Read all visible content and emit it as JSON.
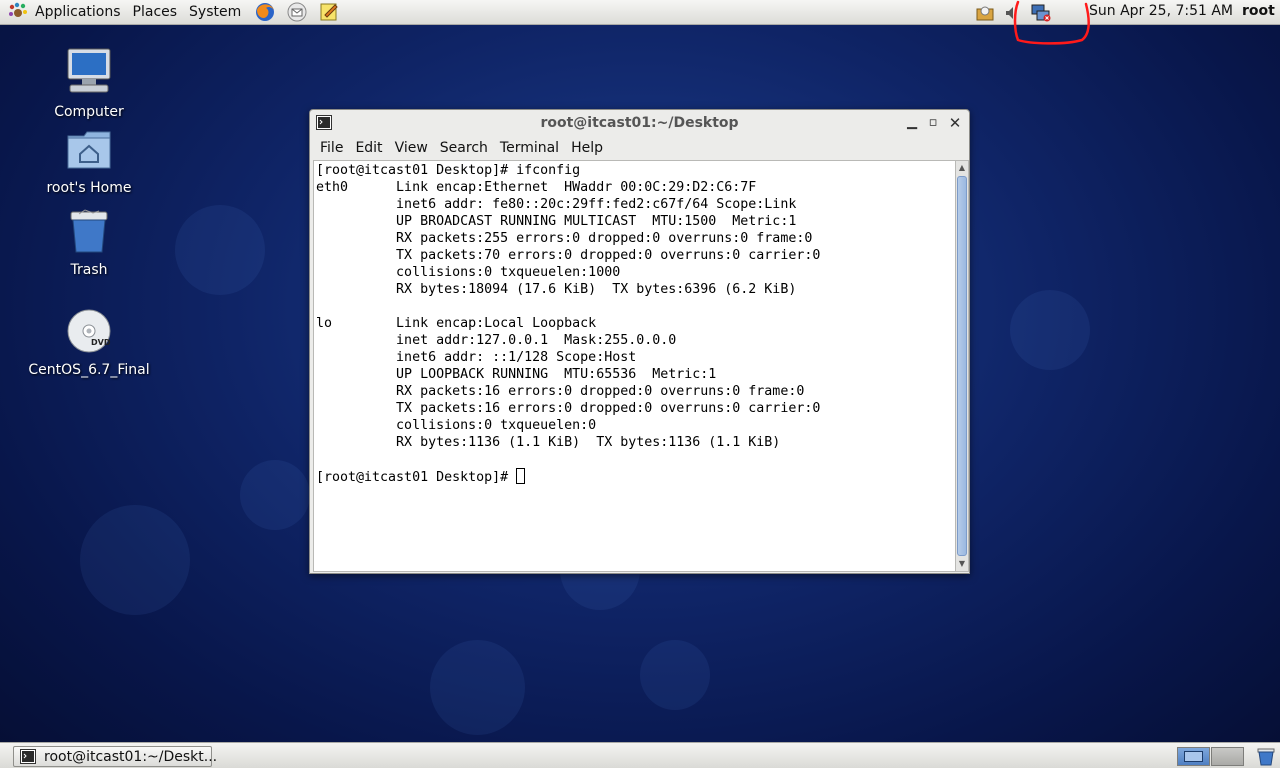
{
  "top_panel": {
    "menus": [
      "Applications",
      "Places",
      "System"
    ],
    "launchers": [
      "firefox-icon",
      "mail-client-icon",
      "notes-editor-icon"
    ],
    "clock": "Sun Apr 25,  7:51 AM",
    "user": "root",
    "tray_icons": [
      "updates-icon",
      "volume-icon",
      "network-disconnected-icon"
    ]
  },
  "desktop": {
    "icons": [
      {
        "label": "Computer",
        "icon": "computer-icon"
      },
      {
        "label": "root's Home",
        "icon": "home-folder-icon"
      },
      {
        "label": "Trash",
        "icon": "trash-icon"
      },
      {
        "label": "CentOS_6.7_Final",
        "icon": "dvd-icon"
      }
    ]
  },
  "terminal": {
    "title": "root@itcast01:~/Desktop",
    "menus": [
      "File",
      "Edit",
      "View",
      "Search",
      "Terminal",
      "Help"
    ],
    "lines": [
      "[root@itcast01 Desktop]# ifconfig",
      "eth0      Link encap:Ethernet  HWaddr 00:0C:29:D2:C6:7F",
      "          inet6 addr: fe80::20c:29ff:fed2:c67f/64 Scope:Link",
      "          UP BROADCAST RUNNING MULTICAST  MTU:1500  Metric:1",
      "          RX packets:255 errors:0 dropped:0 overruns:0 frame:0",
      "          TX packets:70 errors:0 dropped:0 overruns:0 carrier:0",
      "          collisions:0 txqueuelen:1000",
      "          RX bytes:18094 (17.6 KiB)  TX bytes:6396 (6.2 KiB)",
      "",
      "lo        Link encap:Local Loopback",
      "          inet addr:127.0.0.1  Mask:255.0.0.0",
      "          inet6 addr: ::1/128 Scope:Host",
      "          UP LOOPBACK RUNNING  MTU:65536  Metric:1",
      "          RX packets:16 errors:0 dropped:0 overruns:0 frame:0",
      "          TX packets:16 errors:0 dropped:0 overruns:0 carrier:0",
      "          collisions:0 txqueuelen:0",
      "          RX bytes:1136 (1.1 KiB)  TX bytes:1136 (1.1 KiB)",
      ""
    ],
    "prompt": "[root@itcast01 Desktop]# "
  },
  "bottom_panel": {
    "task": "root@itcast01:~/Deskt...",
    "workspaces": 2,
    "active_workspace": 1
  },
  "colors": {
    "annotation": "#ff1a1a",
    "desktop_bg": "#0f2466"
  }
}
